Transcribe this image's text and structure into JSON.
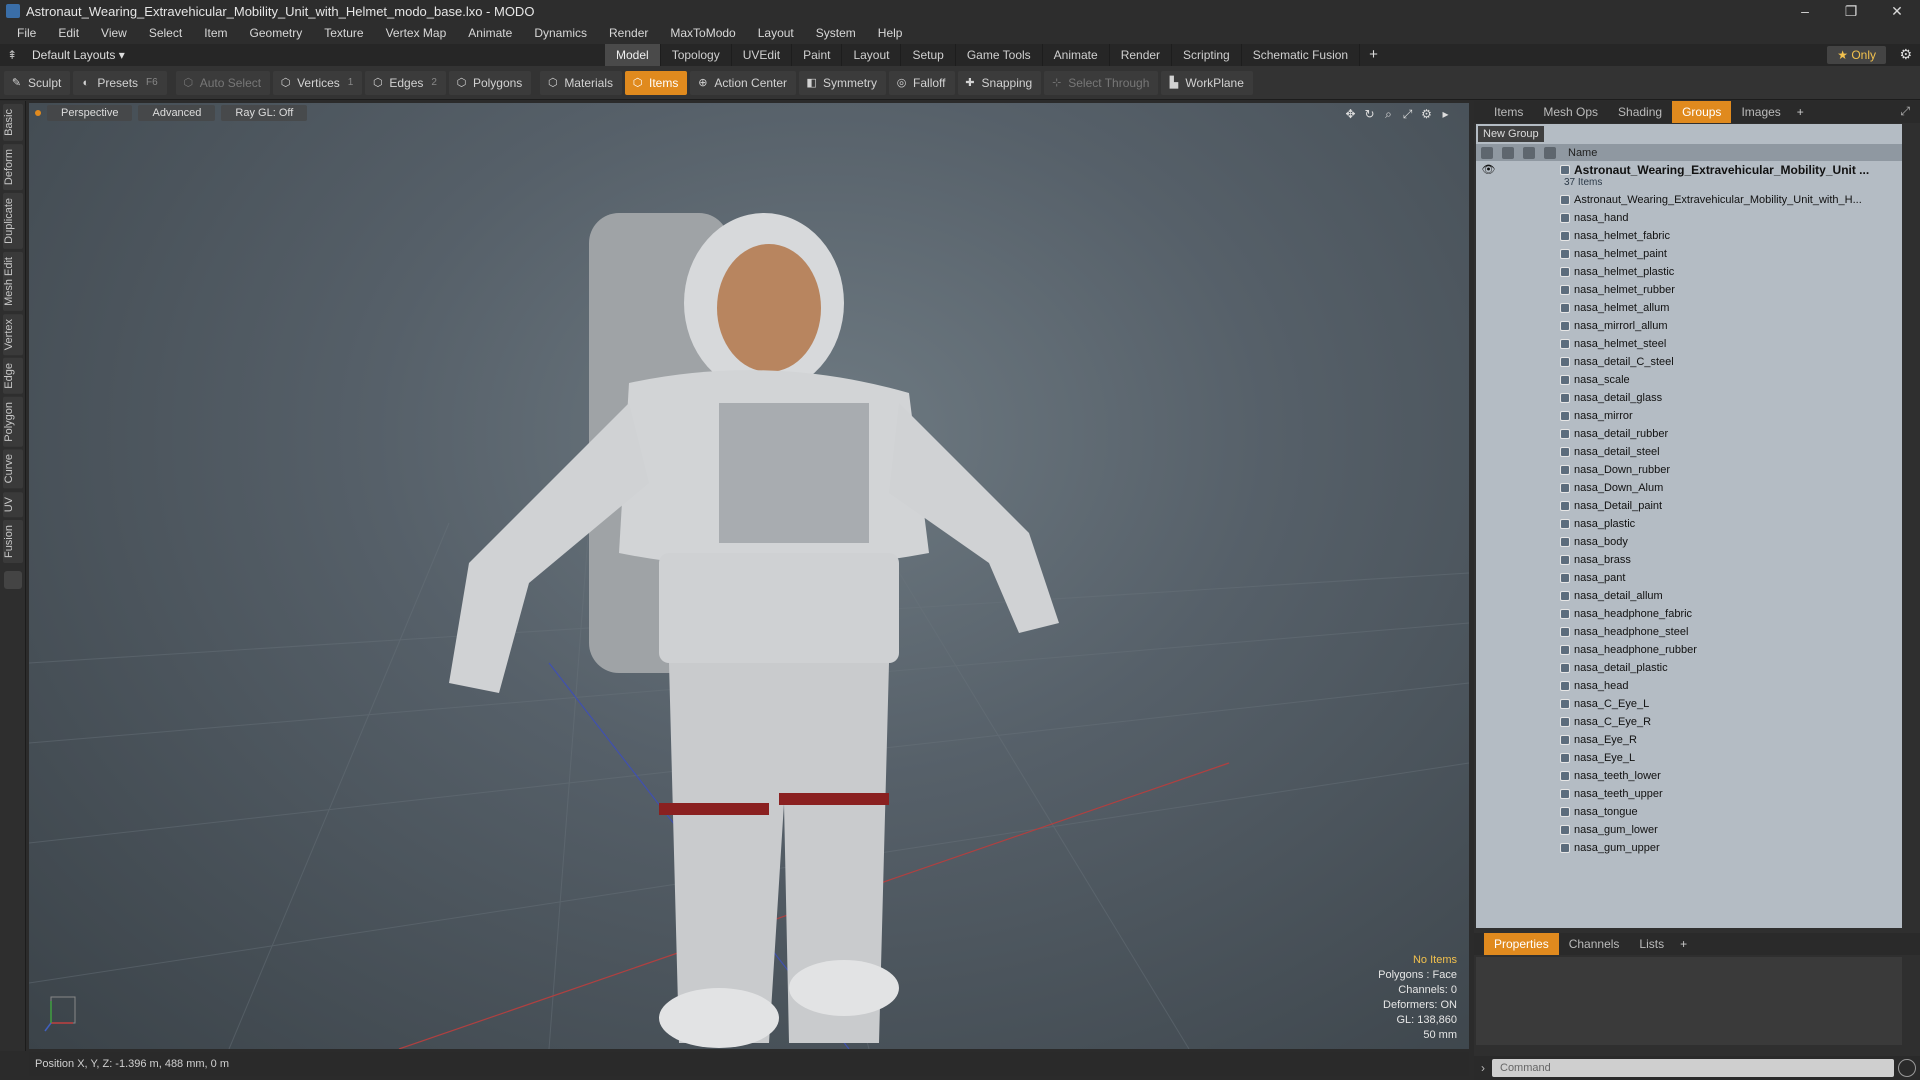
{
  "window": {
    "title": "Astronaut_Wearing_Extravehicular_Mobility_Unit_with_Helmet_modo_base.lxo - MODO",
    "controls": [
      "–",
      "❐",
      "✕"
    ]
  },
  "menu": [
    "File",
    "Edit",
    "View",
    "Select",
    "Item",
    "Geometry",
    "Texture",
    "Vertex Map",
    "Animate",
    "Dynamics",
    "Render",
    "MaxToModo",
    "Layout",
    "System",
    "Help"
  ],
  "layoutbar": {
    "layout_label": "Default Layouts ▾",
    "tabs": [
      "Model",
      "Topology",
      "UVEdit",
      "Paint",
      "Layout",
      "Setup",
      "Game Tools",
      "Animate",
      "Render",
      "Scripting",
      "Schematic Fusion"
    ],
    "active_tab": "Model",
    "add": "+",
    "only_label": "★ Only"
  },
  "toolbar": {
    "sculpt": "Sculpt",
    "presets": "Presets",
    "presets_key": "F6",
    "auto_select": "Auto Select",
    "vertices": "Vertices",
    "vertices_key": "1",
    "edges": "Edges",
    "edges_key": "2",
    "polygons": "Polygons",
    "materials": "Materials",
    "items": "Items",
    "action_center": "Action Center",
    "symmetry": "Symmetry",
    "falloff": "Falloff",
    "snapping": "Snapping",
    "select_through": "Select Through",
    "workplane": "WorkPlane"
  },
  "left_tabs": [
    "Basic",
    "Deform",
    "Duplicate",
    "Mesh Edit",
    "Vertex",
    "Edge",
    "Polygon",
    "Curve",
    "UV",
    "Fusion"
  ],
  "viewport": {
    "view_mode": "Perspective",
    "shading": "Advanced",
    "raygl": "Ray GL: Off",
    "info": {
      "no_items": "No Items",
      "polygons": "Polygons : Face",
      "channels": "Channels: 0",
      "deformers": "Deformers: ON",
      "gl": "GL: 138,860",
      "scale": "50 mm"
    }
  },
  "status": {
    "position": "Position X, Y, Z:  -1.396 m, 488 mm, 0 m"
  },
  "panel": {
    "tabs": [
      "Items",
      "Mesh Ops",
      "Shading",
      "Groups",
      "Images"
    ],
    "active_tab": "Groups",
    "new_group": "New Group",
    "column_name": "Name",
    "root_group": "Astronaut_Wearing_Extravehicular_Mobility_Unit ...",
    "root_count": "37 Items",
    "root_mesh": "Astronaut_Wearing_Extravehicular_Mobility_Unit_with_H...",
    "items": [
      "nasa_hand",
      "nasa_helmet_fabric",
      "nasa_helmet_paint",
      "nasa_helmet_plastic",
      "nasa_helmet_rubber",
      "nasa_helmet_allum",
      "nasa_mirrorl_allum",
      "nasa_helmet_steel",
      "nasa_detail_C_steel",
      "nasa_scale",
      "nasa_detail_glass",
      "nasa_mirror",
      "nasa_detail_rubber",
      "nasa_detail_steel",
      "nasa_Down_rubber",
      "nasa_Down_Alum",
      "nasa_Detail_paint",
      "nasa_plastic",
      "nasa_body",
      "nasa_brass",
      "nasa_pant",
      "nasa_detail_allum",
      "nasa_headphone_fabric",
      "nasa_headphone_steel",
      "nasa_headphone_rubber",
      "nasa_detail_plastic",
      "nasa_head",
      "nasa_C_Eye_L",
      "nasa_C_Eye_R",
      "nasa_Eye_R",
      "nasa_Eye_L",
      "nasa_teeth_lower",
      "nasa_teeth_upper",
      "nasa_tongue",
      "nasa_gum_lower",
      "nasa_gum_upper"
    ],
    "props_tabs": [
      "Properties",
      "Channels",
      "Lists"
    ],
    "props_active": "Properties",
    "command_placeholder": "Command"
  },
  "colors": {
    "accent": "#e08a1e",
    "panel_list_bg": "#b4bcc4",
    "viewport_center": "#6e7a82"
  }
}
